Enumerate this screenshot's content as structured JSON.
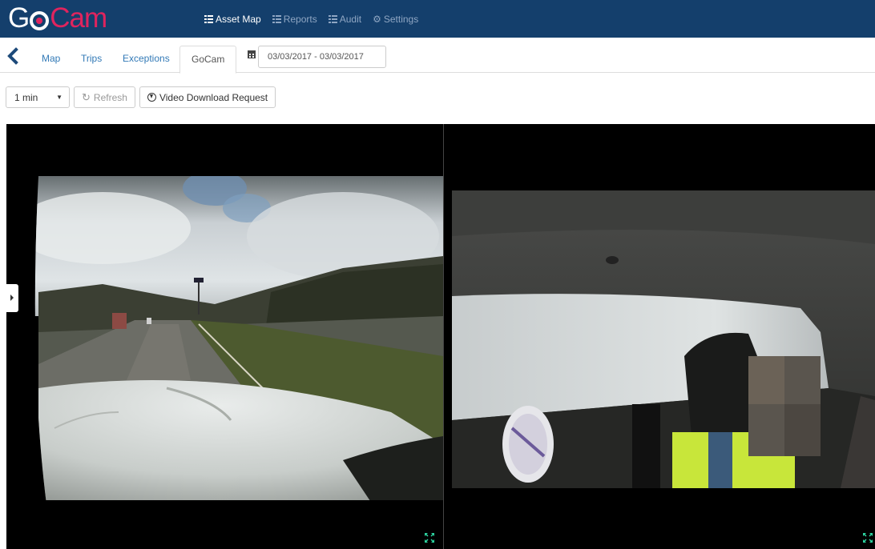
{
  "app": {
    "logo_go": "G",
    "logo_cam": "Cam"
  },
  "nav": {
    "items": [
      {
        "label": "Asset Map",
        "icon": "list-icon",
        "active": true
      },
      {
        "label": "Reports",
        "icon": "list-icon",
        "active": false
      },
      {
        "label": "Audit",
        "icon": "list-icon",
        "active": false
      },
      {
        "label": "Settings",
        "icon": "gear-icon",
        "active": false
      }
    ]
  },
  "tabs": {
    "items": [
      {
        "label": "Map",
        "active": false
      },
      {
        "label": "Trips",
        "active": false
      },
      {
        "label": "Exceptions",
        "active": false
      },
      {
        "label": "GoCam",
        "active": true
      }
    ],
    "date_range": "03/03/2017 - 03/03/2017"
  },
  "toolbar": {
    "interval": "1 min",
    "refresh_label": "Refresh",
    "download_label": "Video Download Request"
  },
  "videos": {
    "left": {
      "view": "road-facing camera"
    },
    "right": {
      "view": "driver-facing camera"
    }
  },
  "colors": {
    "header_bg": "#143f6c",
    "brand_red": "#e0245e",
    "link": "#337ab7",
    "expand_icon": "#2ed3a0"
  }
}
